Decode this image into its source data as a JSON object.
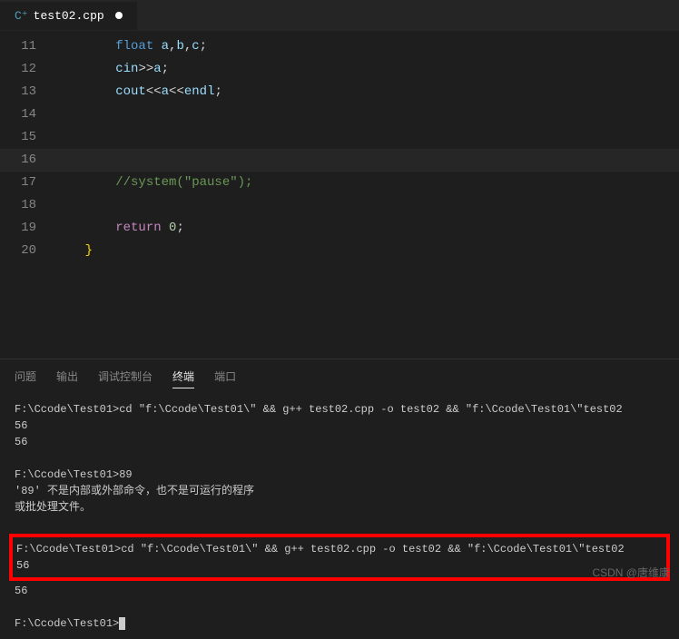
{
  "tab": {
    "filename": "test02.cpp",
    "modified": true
  },
  "editor": {
    "lines": [
      {
        "num": "11",
        "indent": "        ",
        "tokens": [
          {
            "t": "type",
            "v": "float"
          },
          {
            "t": "punc",
            "v": " "
          },
          {
            "t": "var",
            "v": "a"
          },
          {
            "t": "punc",
            "v": ","
          },
          {
            "t": "var",
            "v": "b"
          },
          {
            "t": "punc",
            "v": ","
          },
          {
            "t": "var",
            "v": "c"
          },
          {
            "t": "punc",
            "v": ";"
          }
        ]
      },
      {
        "num": "12",
        "indent": "        ",
        "tokens": [
          {
            "t": "var",
            "v": "cin"
          },
          {
            "t": "op",
            "v": ">>"
          },
          {
            "t": "var",
            "v": "a"
          },
          {
            "t": "punc",
            "v": ";"
          }
        ]
      },
      {
        "num": "13",
        "indent": "        ",
        "tokens": [
          {
            "t": "var",
            "v": "cout"
          },
          {
            "t": "op",
            "v": "<<"
          },
          {
            "t": "var",
            "v": "a"
          },
          {
            "t": "op",
            "v": "<<"
          },
          {
            "t": "var",
            "v": "endl"
          },
          {
            "t": "punc",
            "v": ";"
          }
        ]
      },
      {
        "num": "14",
        "indent": "",
        "tokens": []
      },
      {
        "num": "15",
        "indent": "",
        "tokens": []
      },
      {
        "num": "16",
        "indent": "",
        "tokens": [],
        "active": true
      },
      {
        "num": "17",
        "indent": "        ",
        "tokens": [
          {
            "t": "comment",
            "v": "//system(\"pause\");"
          }
        ]
      },
      {
        "num": "18",
        "indent": "",
        "tokens": []
      },
      {
        "num": "19",
        "indent": "        ",
        "tokens": [
          {
            "t": "keyword",
            "v": "return"
          },
          {
            "t": "punc",
            "v": " "
          },
          {
            "t": "num",
            "v": "0"
          },
          {
            "t": "punc",
            "v": ";"
          }
        ]
      },
      {
        "num": "20",
        "indent": "    ",
        "tokens": [
          {
            "t": "brace",
            "v": "}"
          }
        ]
      }
    ]
  },
  "panel": {
    "tabs": {
      "problems": "问题",
      "output": "输出",
      "debug": "调试控制台",
      "terminal": "终端",
      "ports": "端口"
    },
    "active": "terminal"
  },
  "terminal": {
    "lines": [
      {
        "text": "F:\\Ccode\\Test01>cd \"f:\\Ccode\\Test01\\\" && g++ test02.cpp -o test02 && \"f:\\Ccode\\Test01\\\"test02"
      },
      {
        "text": "56"
      },
      {
        "text": "56"
      },
      {
        "blank": true
      },
      {
        "text": "F:\\Ccode\\Test01>89"
      },
      {
        "text": "'89' 不是内部或外部命令，也不是可运行的程序"
      },
      {
        "text": "或批处理文件。"
      },
      {
        "blank": true
      },
      {
        "highlighted": true,
        "lines": [
          {
            "text": "F:\\Ccode\\Test01>cd \"f:\\Ccode\\Test01\\\" && g++ test02.cpp -o test02 && \"f:\\Ccode\\Test01\\\"test02"
          },
          {
            "text": "56"
          }
        ]
      },
      {
        "text": "56"
      },
      {
        "blank": true
      },
      {
        "prompt": "F:\\Ccode\\Test01>",
        "cursor": true
      }
    ]
  },
  "watermark": "CSDN @唐维康"
}
